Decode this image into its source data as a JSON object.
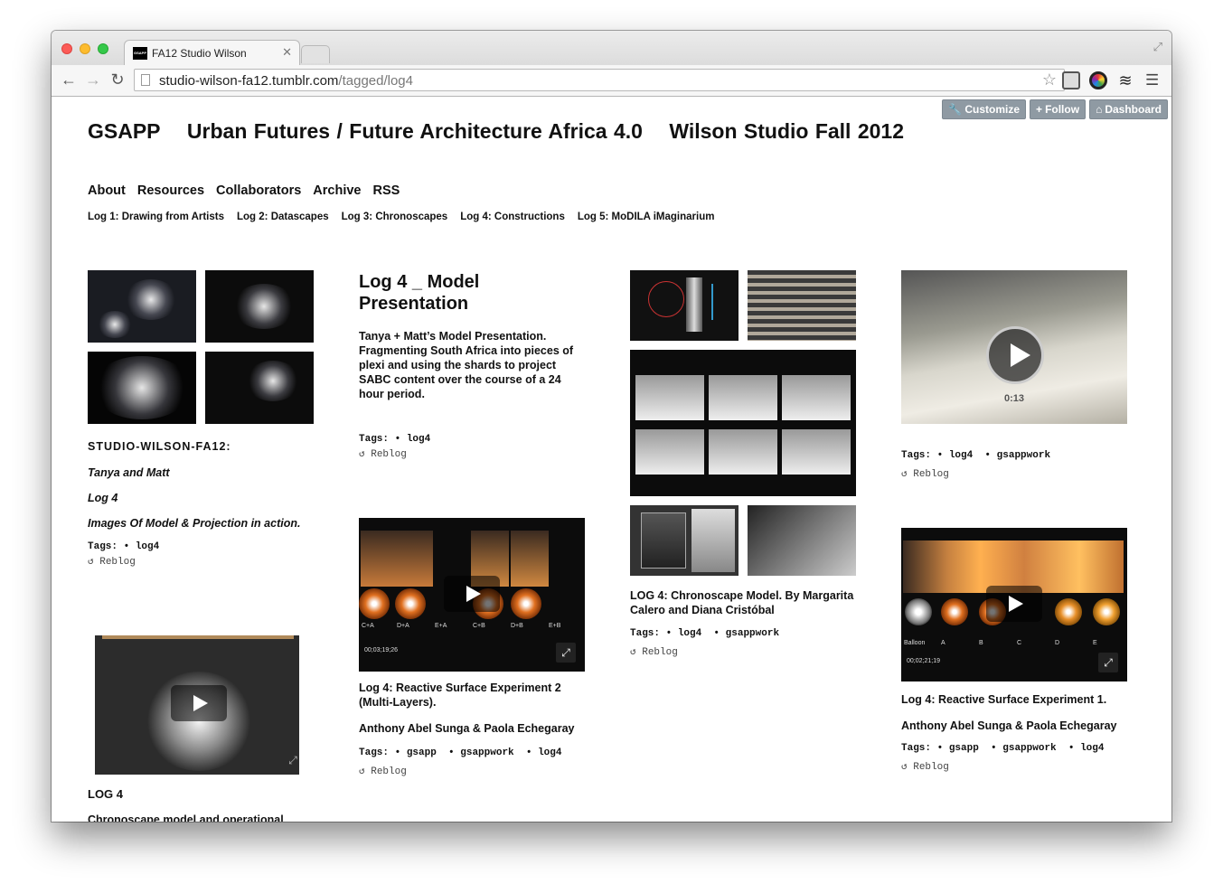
{
  "browser": {
    "tab_title": "FA12 Studio Wilson",
    "tab_favicon_text": "GSAPP",
    "url_host": "studio-wilson-fa12.tumblr.com",
    "url_path": "/tagged/log4"
  },
  "tumblr_controls": {
    "customize": "Customize",
    "follow": "Follow",
    "dashboard": "Dashboard"
  },
  "site": {
    "title_parts": [
      "GSAPP",
      "Urban Futures / Future Architecture Africa 4.0",
      "Wilson Studio Fall 2012"
    ],
    "nav": [
      "About",
      "Resources",
      "Collaborators",
      "Archive",
      "RSS"
    ],
    "logs": [
      "Log 1: Drawing from Artists",
      "Log 2: Datascapes",
      "Log 3: Chronoscapes",
      "Log 4: Constructions",
      "Log 5: MoDILA iMaginarium"
    ]
  },
  "posts": {
    "p1": {
      "author": "STUDIO-WILSON-FA12:",
      "line1": "Tanya and Matt",
      "line2": "Log 4",
      "line3": "Images Of Model & Projection in action.",
      "tags_label": "Tags:",
      "tags": [
        "log4"
      ],
      "reblog": "Reblog"
    },
    "p2": {
      "title": "Log 4 _ Model Presentation",
      "body": "Tanya + Matt’s Model Presentation. Fragmenting South Africa into pieces of plexi and using the shards to project SABC content over the course of a 24 hour period.",
      "tags_label": "Tags:",
      "tags": [
        "log4"
      ],
      "reblog": "Reblog"
    },
    "p3": {
      "caption": "LOG 4: Chronoscape Model. By Margarita Calero and Diana Cristóbal",
      "tags_label": "Tags:",
      "tags": [
        "log4",
        "gsappwork"
      ],
      "reblog": "Reblog"
    },
    "p4": {
      "video_time": "0:13",
      "tags_label": "Tags:",
      "tags": [
        "log4",
        "gsappwork"
      ],
      "reblog": "Reblog"
    },
    "p5": {
      "title": "Log 4: Reactive Surface Experiment 2 (Multi-Layers).",
      "authors": "Anthony Abel Sunga & Paola Echegaray",
      "timecode": "00;03;19;26",
      "frame_labels": [
        "C+A",
        "D+A",
        "E+A",
        "C+B",
        "D+B",
        "E+B"
      ],
      "tags_label": "Tags:",
      "tags": [
        "gsapp",
        "gsappwork",
        "log4"
      ],
      "reblog": "Reblog"
    },
    "p6": {
      "title": "Log 4: Reactive Surface Experiment 1.",
      "authors": "Anthony Abel Sunga & Paola Echegaray",
      "timecode": "00;02;21;19",
      "frame_labels": [
        "Balloon",
        "A",
        "B",
        "C",
        "D",
        "E"
      ],
      "tags_label": "Tags:",
      "tags": [
        "gsapp",
        "gsappwork",
        "log4"
      ],
      "reblog": "Reblog"
    },
    "p7": {
      "title": "LOG 4",
      "subtitle": "Chronoscape model and operational"
    }
  }
}
